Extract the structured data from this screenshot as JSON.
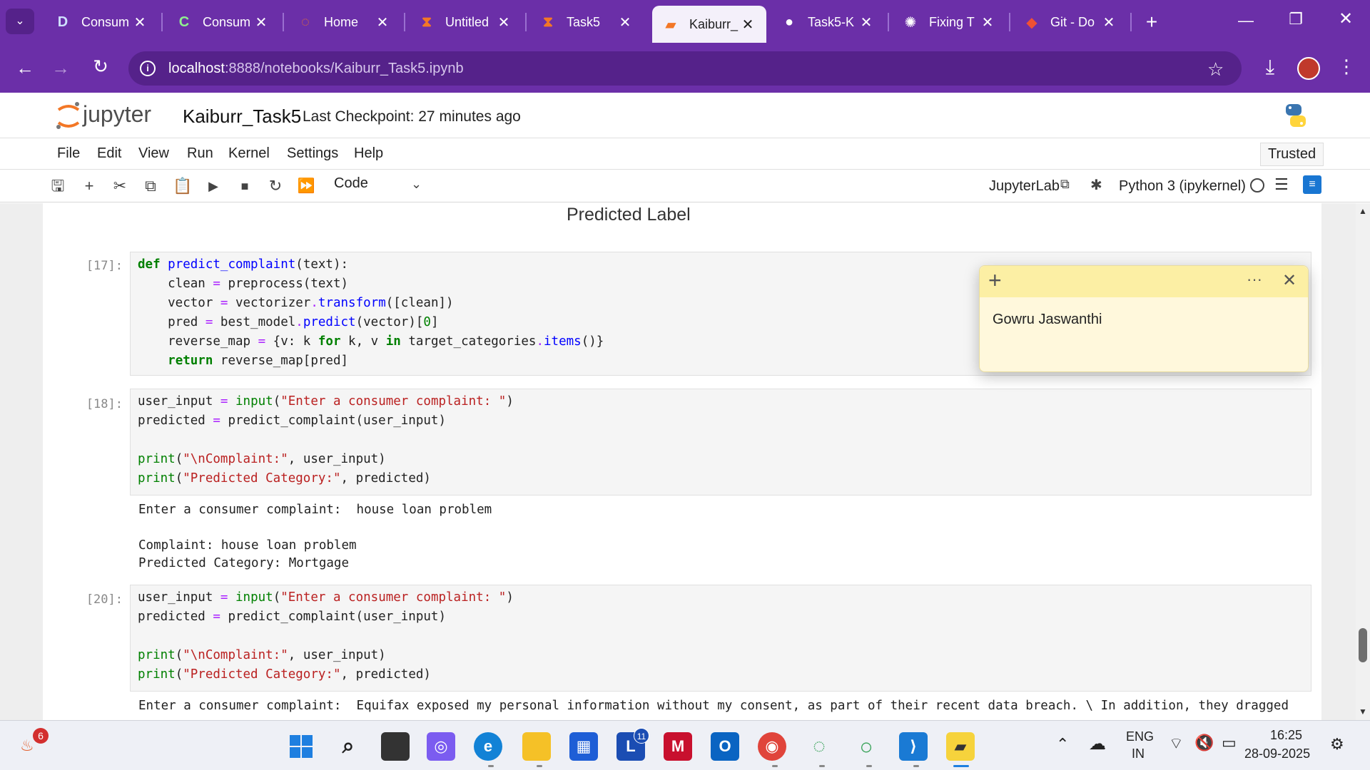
{
  "browser": {
    "tabs": [
      {
        "label": "Consum",
        "icon": "dbt-icon"
      },
      {
        "label": "Consum",
        "icon": "copilot-icon"
      },
      {
        "label": "Home",
        "icon": "jupyter-icon"
      },
      {
        "label": "Untitled",
        "icon": "jupyter-icon"
      },
      {
        "label": "Task5",
        "icon": "jupyter-icon"
      },
      {
        "label": "Kaiburr_",
        "icon": "jupyter-icon"
      },
      {
        "label": "Task5-K",
        "icon": "github-icon"
      },
      {
        "label": "Fixing T",
        "icon": "chatgpt-icon"
      },
      {
        "label": "Git - Do",
        "icon": "git-icon"
      }
    ],
    "url_host": "localhost",
    "url_path": ":8888/notebooks/Kaiburr_Task5.ipynb",
    "accent": "#6b2fa8"
  },
  "jupyter": {
    "logo_text": "jupyter",
    "notebook_title": "Kaiburr_Task5",
    "checkpoint": "Last Checkpoint: 27 minutes ago",
    "menu": [
      "File",
      "Edit",
      "View",
      "Run",
      "Kernel",
      "Settings",
      "Help"
    ],
    "trusted": "Trusted",
    "cell_type": "Code",
    "jupyterlab_link": "JupyterLab",
    "kernel": "Python 3 (ipykernel)"
  },
  "notebook": {
    "chart_axis_label": "Predicted Label",
    "cells": [
      {
        "prompt": "[17]:"
      },
      {
        "prompt": "[18]:",
        "output": [
          "Enter a consumer complaint:  house loan problem",
          "",
          "Complaint: house loan problem",
          "Predicted Category: Mortgage"
        ]
      },
      {
        "prompt": "[20]:",
        "output": [
          "Enter a consumer complaint:  Equifax exposed my personal information without my consent, as part of their recent data breach. \\ In addition, they dragged"
        ]
      }
    ]
  },
  "sticky_note": {
    "text": "Gowru Jaswanthi"
  },
  "taskbar": {
    "notification_badge": "6",
    "lang_line1": "ENG",
    "lang_line2": "IN",
    "time": "16:25",
    "date": "28-09-2025",
    "l_badge": "11"
  }
}
